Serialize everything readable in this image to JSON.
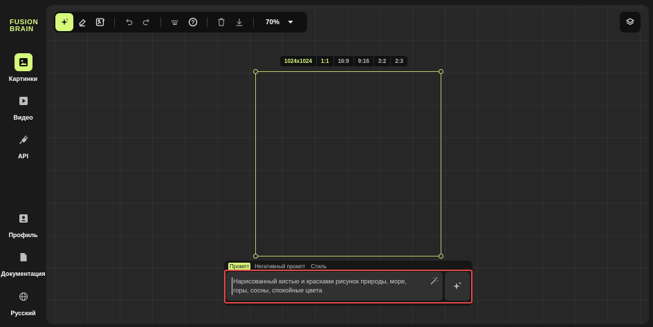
{
  "brand": {
    "line1": "FUSION",
    "line2": "BRAIN"
  },
  "sidebar": {
    "top_items": [
      {
        "label": "Картинки",
        "icon": "image-icon",
        "active": true
      },
      {
        "label": "Видео",
        "icon": "play-icon",
        "active": false
      },
      {
        "label": "API",
        "icon": "plug-icon",
        "active": false
      }
    ],
    "bottom_items": [
      {
        "label": "Профиль",
        "icon": "profile-icon"
      },
      {
        "label": "Документация",
        "icon": "document-icon"
      },
      {
        "label": "Русский",
        "icon": "globe-icon"
      }
    ]
  },
  "toolbar": {
    "tools": [
      "sparkle-icon",
      "eraser-icon",
      "image-edit-icon",
      "undo-icon",
      "redo-icon",
      "keyboard-icon",
      "help-icon",
      "trash-icon",
      "download-icon"
    ],
    "active_tool": "sparkle-icon",
    "zoom": "70%"
  },
  "canvas": {
    "size_label": "1024x1024",
    "ratios": [
      "1:1",
      "16:9",
      "9:16",
      "3:2",
      "2:3"
    ],
    "selected_ratio": "1:1"
  },
  "prompt": {
    "tabs": [
      "Промпт",
      "Негативный промпт",
      "Стиль"
    ],
    "active_tab": "Промпт",
    "text": "Нарисованный кистью и красками рисунок природы, море, горы, сосны, спокойные цвета"
  },
  "colors": {
    "accent": "#d6f97c",
    "highlight": "#e14845",
    "canvas_bg": "#272727",
    "sidebar_bg": "#1a1a1a"
  }
}
